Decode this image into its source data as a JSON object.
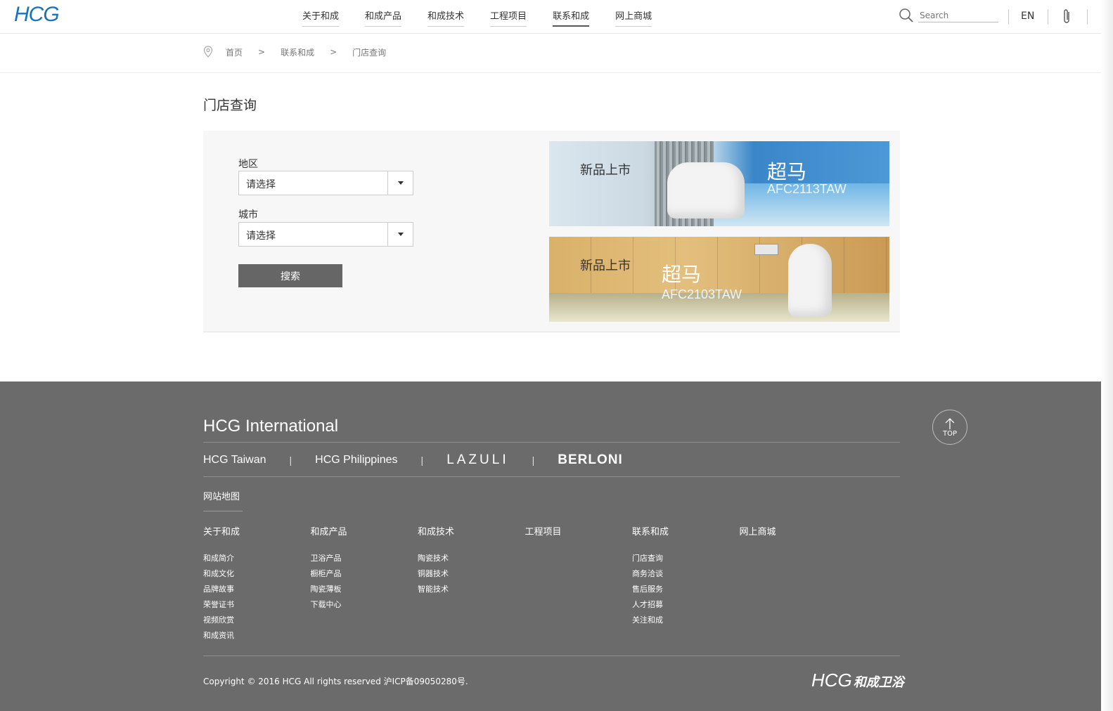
{
  "header": {
    "logo": "HCG",
    "nav": [
      "关于和成",
      "和成产品",
      "和成技术",
      "工程项目",
      "联系和成",
      "网上商城"
    ],
    "search_placeholder": "Search",
    "lang": "EN"
  },
  "breadcrumb": [
    "首页",
    "联系和成",
    "门店查询"
  ],
  "breadcrumb_sep": ">",
  "page_title": "门店查询",
  "form": {
    "region_label": "地区",
    "region_value": "请选择",
    "city_label": "城市",
    "city_value": "请选择",
    "search_button": "搜索"
  },
  "banners": [
    {
      "tag": "新品上市",
      "name": "超马",
      "model": "AFC2113TAW"
    },
    {
      "tag": "新品上市",
      "name": "超马",
      "model": "AFC2103TAW"
    }
  ],
  "footer": {
    "title": "HCG International",
    "brands": [
      "HCG Taiwan",
      "HCG Philippines",
      "LAZULI",
      "BERLONI"
    ],
    "brand_sep": "|",
    "sitemap": "网站地图",
    "columns": [
      {
        "title": "关于和成",
        "items": [
          "和成简介",
          "和成文化",
          "品牌故事",
          "荣誉证书",
          "视频欣赏",
          "和成资讯"
        ]
      },
      {
        "title": "和成产品",
        "items": [
          "卫浴产品",
          "橱柜产品",
          "陶瓷薄板",
          "下载中心"
        ]
      },
      {
        "title": "和成技术",
        "items": [
          "陶瓷技术",
          "铜器技术",
          "智能技术"
        ]
      },
      {
        "title": "工程项目",
        "items": []
      },
      {
        "title": "联系和成",
        "items": [
          "门店查询",
          "商务洽谈",
          "售后服务",
          "人才招募",
          "关注和成"
        ]
      },
      {
        "title": "网上商城",
        "items": []
      }
    ],
    "copyright": "Copyright © 2016 HCG All rights reserved 沪ICP备09050280号.",
    "footer_logo": "HCG",
    "footer_logo_cn": "和成卫浴",
    "top_label": "TOP"
  },
  "colors": {
    "brand_blue": "#1a73b8",
    "footer_bg": "#6b6b6b",
    "button_bg": "#666666"
  }
}
